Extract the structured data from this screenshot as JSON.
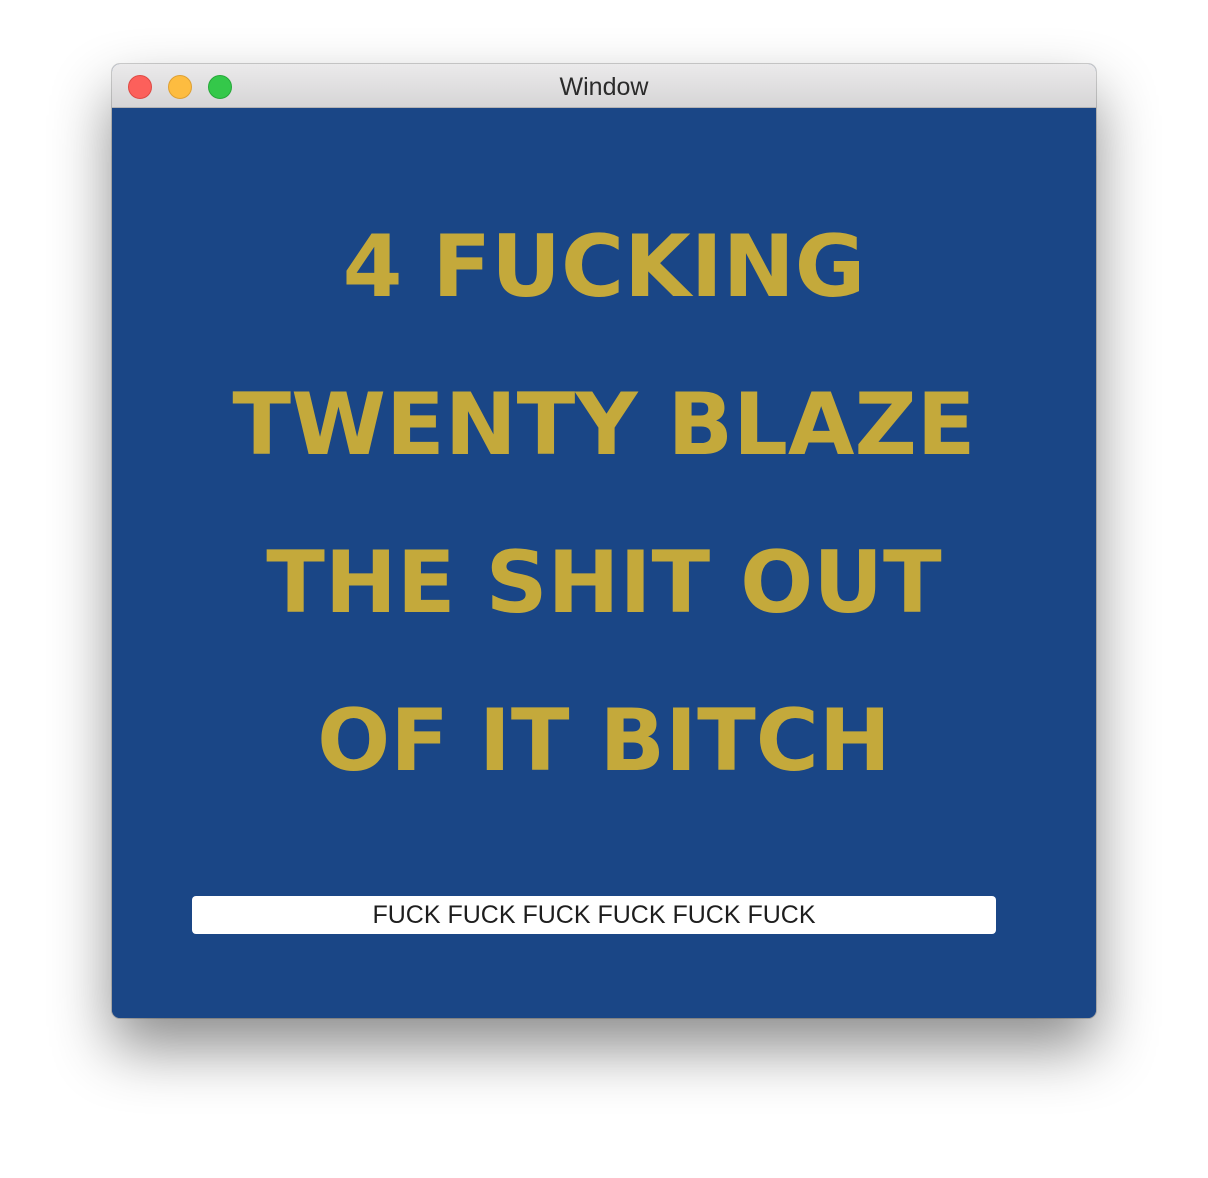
{
  "window": {
    "title": "Window"
  },
  "headline": {
    "lines": [
      "4 FUCKING",
      "TWENTY BLAZE",
      "THE SHIT OUT",
      "OF IT BITCH"
    ]
  },
  "text_field": {
    "value": "FUCK FUCK FUCK FUCK FUCK FUCK"
  },
  "colors": {
    "background": "#1a4686",
    "headline_text": "#c4a93b",
    "close": "#fc605b",
    "minimize": "#fdbc40",
    "maximize": "#34c84a"
  }
}
